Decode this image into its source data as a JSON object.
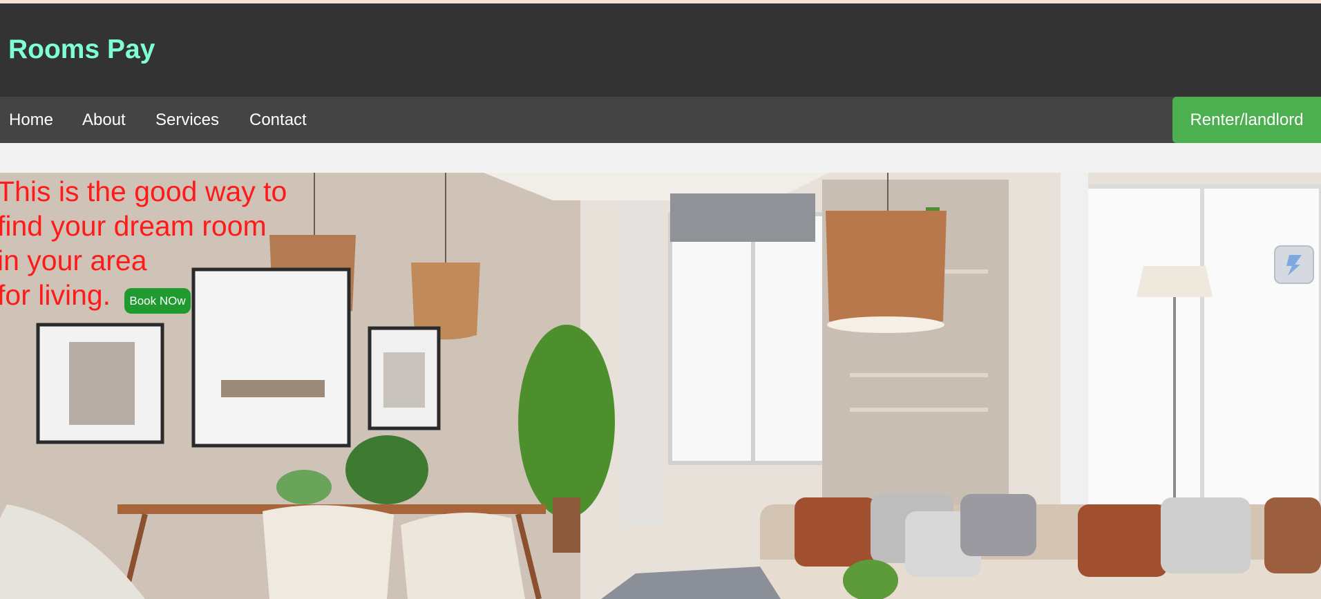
{
  "header": {
    "brand": "Rooms Pay"
  },
  "nav": {
    "items": [
      {
        "label": "Home"
      },
      {
        "label": "About"
      },
      {
        "label": "Services"
      },
      {
        "label": "Contact"
      }
    ],
    "renter_button": "Renter/landlord"
  },
  "hero": {
    "tagline_lines": [
      "This is the good way to",
      "find your dream room",
      "in your area",
      "for living."
    ],
    "book_button": "Book NOw",
    "image": "living-room-photo"
  },
  "widget": {
    "icon": "lightning-icon"
  },
  "colors": {
    "header_bg": "#333333",
    "nav_bg": "#444444",
    "brand": "#7fffd4",
    "renter_button": "#4caf50",
    "tagline": "#ff1a1a",
    "book_button": "#1f9a2e"
  }
}
